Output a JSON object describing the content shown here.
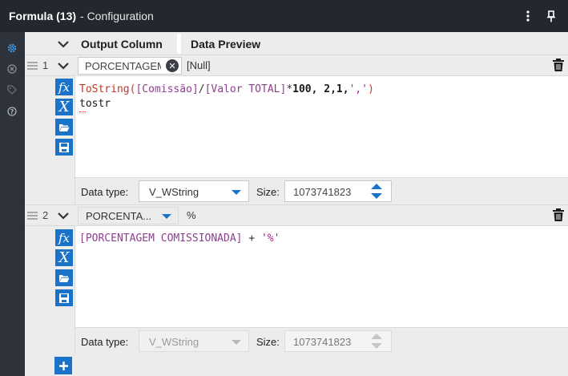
{
  "titlebar": {
    "title": "Formula (13)",
    "subtitle": "- Configuration",
    "menu_icon": "kebab-menu-icon",
    "pin_icon": "pin-icon"
  },
  "sidebar": {
    "items": [
      {
        "icon": "gear-icon",
        "active": true
      },
      {
        "icon": "circle-x-icon",
        "active": false
      },
      {
        "icon": "tag-icon",
        "active": false
      },
      {
        "icon": "help-icon",
        "active": false
      }
    ]
  },
  "header": {
    "output_column": "Output Column",
    "data_preview": "Data Preview"
  },
  "rows": [
    {
      "number": "1",
      "output_field": "PORCENTAGEM",
      "preview": "[Null]",
      "expression_line1": {
        "fn": "ToString(",
        "field1": "[Comissão]",
        "op1": "/",
        "field2": "[Valor TOTAL]",
        "op2": "*",
        "num": "100, 2,1,",
        "str": "','",
        "close": ")"
      },
      "expression_line2": "tostr",
      "data_type_label": "Data type:",
      "data_type": "V_WString",
      "size_label": "Size:",
      "size": "1073741823"
    },
    {
      "number": "2",
      "output_field": "PORCENTA...",
      "preview": "%",
      "expression_line1": {
        "field": "[PORCENTAGEM COMISSIONADA]",
        "op": " + ",
        "str": "'%'"
      },
      "data_type_label": "Data type:",
      "data_type": "V_WString",
      "size_label": "Size:",
      "size": "1073741823"
    }
  ],
  "tools": {
    "fx": "fx",
    "variable": "X"
  },
  "colors": {
    "accent": "#1a73c9",
    "titlebar": "#23272e",
    "sidebar": "#2d323b",
    "function": "#c0392b",
    "field": "#8e3f8e",
    "string": "#b01c8c"
  }
}
